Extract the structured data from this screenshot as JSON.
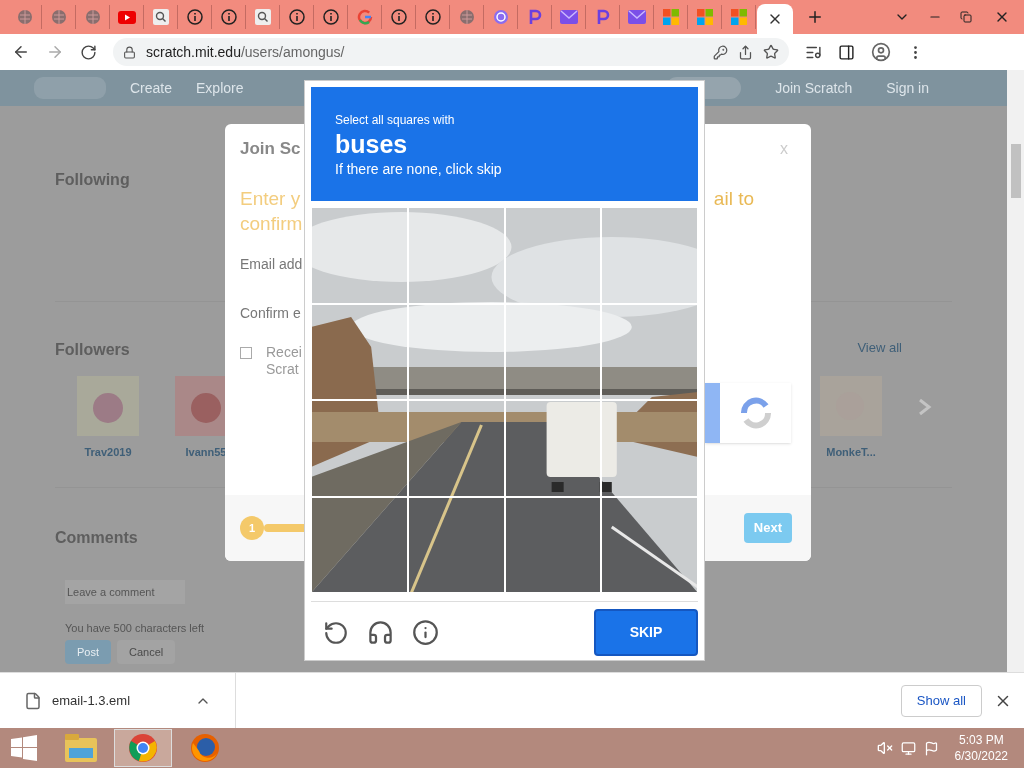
{
  "browser": {
    "tabs": [
      {
        "kind": "globe",
        "selected": false
      },
      {
        "kind": "globe",
        "selected": false
      },
      {
        "kind": "globe",
        "selected": false
      },
      {
        "kind": "video",
        "selected": false
      },
      {
        "kind": "search",
        "selected": false
      },
      {
        "kind": "info",
        "selected": false
      },
      {
        "kind": "info",
        "selected": false
      },
      {
        "kind": "search",
        "selected": false
      },
      {
        "kind": "info",
        "selected": false
      },
      {
        "kind": "info",
        "selected": false
      },
      {
        "kind": "g",
        "selected": false
      },
      {
        "kind": "info",
        "selected": false
      },
      {
        "kind": "info",
        "selected": false
      },
      {
        "kind": "globe",
        "selected": false
      },
      {
        "kind": "swirl",
        "selected": false
      },
      {
        "kind": "p",
        "selected": false
      },
      {
        "kind": "mail",
        "selected": false
      },
      {
        "kind": "p",
        "selected": false
      },
      {
        "kind": "mail",
        "selected": false
      },
      {
        "kind": "windows",
        "selected": false
      },
      {
        "kind": "windows",
        "selected": false
      },
      {
        "kind": "windows",
        "selected": false
      },
      {
        "selected": true
      }
    ],
    "url_host": "scratch.mit.edu",
    "url_path": "/users/amongus/"
  },
  "page": {
    "nav": [
      "Create",
      "Explore"
    ],
    "nav_right": [
      "Join Scratch",
      "Sign in"
    ],
    "following_title": "Following",
    "followers_title": "Followers",
    "view_all": "View all",
    "followers_left": [
      "Trav2019",
      "Ivann55"
    ],
    "followers_right": [
      "MonkeT..."
    ],
    "comments_title": "Comments",
    "comment_placeholder": "Leave a comment",
    "chars_left": "You have 500 characters left",
    "post": "Post",
    "cancel": "Cancel"
  },
  "join_modal": {
    "title": "Join Sc",
    "close": "x",
    "heading_left": [
      "Enter y",
      "confirm"
    ],
    "heading_right": "ail to",
    "email_label": "Email add",
    "confirm_label": "Confirm e",
    "checkbox": {
      "checked": false,
      "lines": [
        "Recei",
        "Scrat"
      ]
    },
    "step": "1",
    "next": "Next"
  },
  "captcha": {
    "prompt": "Select all squares with",
    "target": "buses",
    "hint": "If there are none, click skip",
    "tiles": [
      {
        "selected": false
      },
      {
        "selected": false
      },
      {
        "selected": false
      },
      {
        "selected": false
      },
      {
        "selected": false
      },
      {
        "selected": false
      },
      {
        "selected": false
      },
      {
        "selected": false
      },
      {
        "selected": false
      },
      {
        "selected": false
      },
      {
        "selected": false
      },
      {
        "selected": false
      },
      {
        "selected": false
      },
      {
        "selected": false
      },
      {
        "selected": false
      },
      {
        "selected": false
      }
    ],
    "skip": "SKIP"
  },
  "downloads": {
    "file": "email-1.3.eml",
    "show_all": "Show all"
  },
  "taskbar": {
    "apps": [
      {
        "kind": "folder",
        "selected": false
      },
      {
        "kind": "chrome",
        "selected": true
      },
      {
        "kind": "firefox",
        "selected": false
      }
    ],
    "time": "5:03 PM",
    "date": "6/30/2022"
  }
}
